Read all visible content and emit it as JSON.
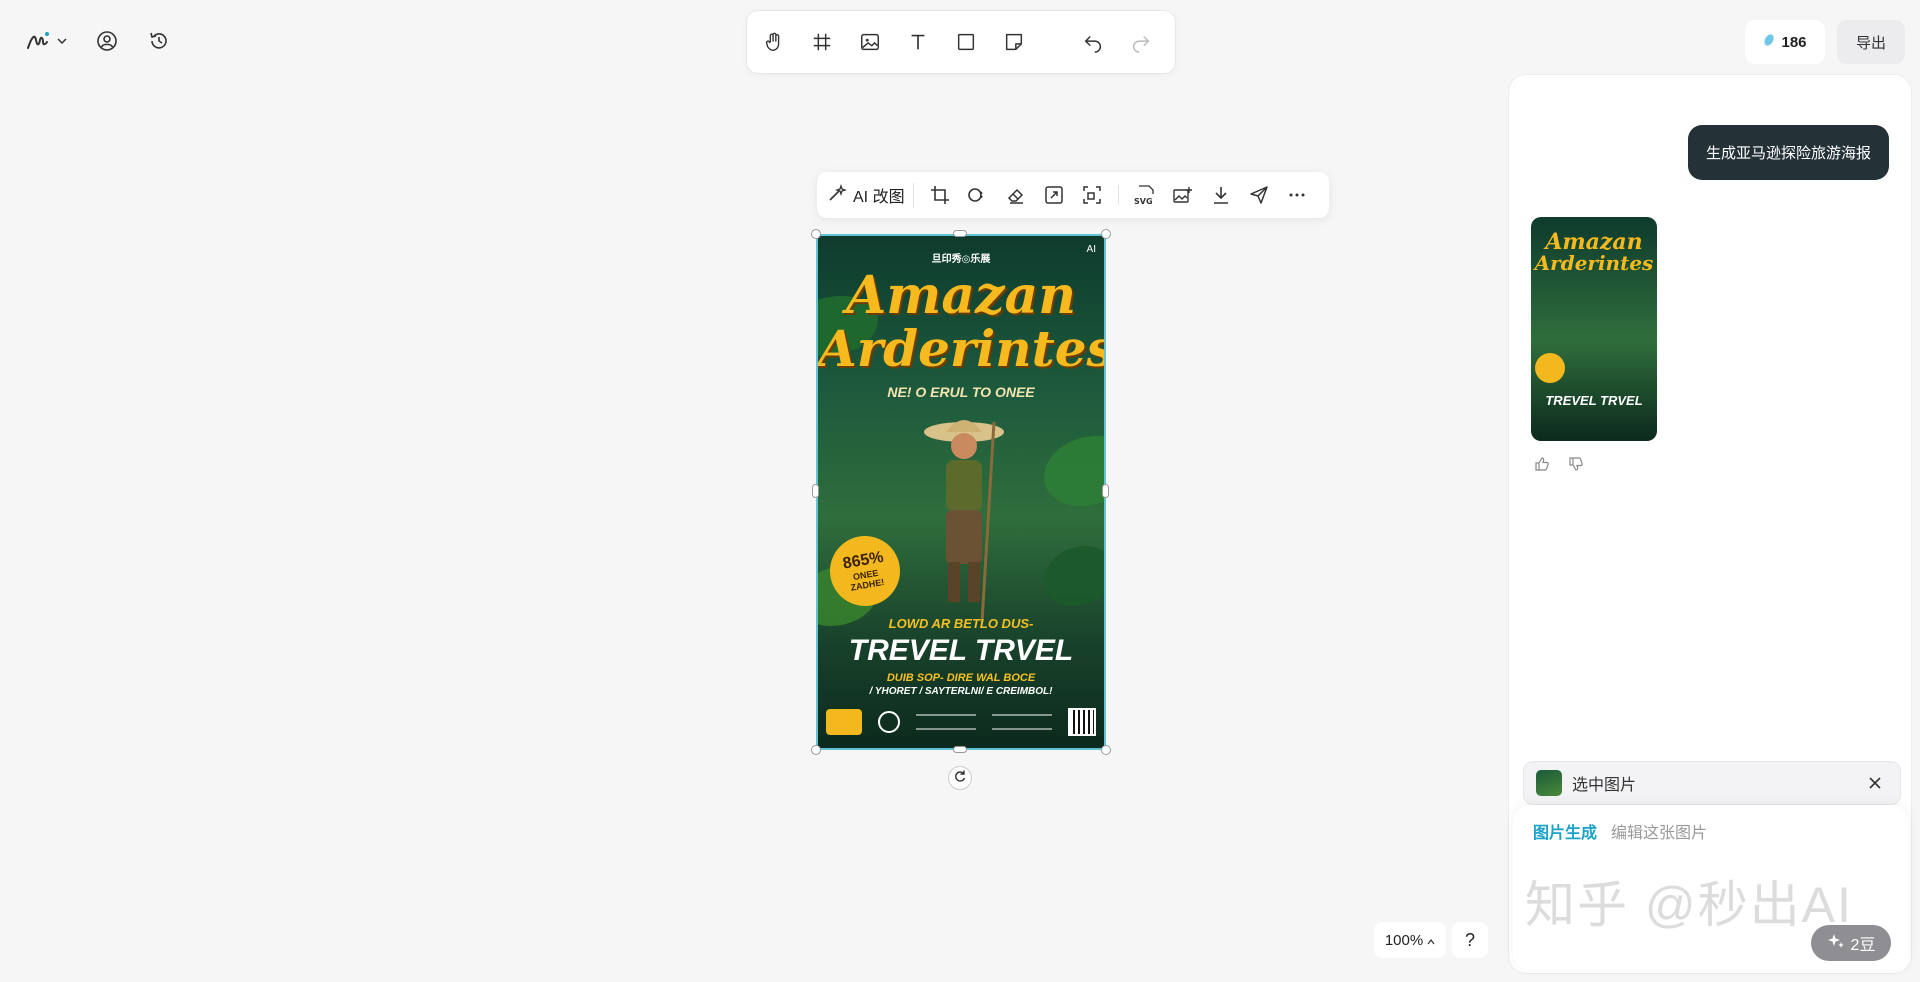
{
  "app": {
    "header_icons": [
      "pen-logo-icon",
      "chevron-down-icon",
      "user-icon",
      "history-icon"
    ]
  },
  "toolbar": {
    "tools": [
      "hand-icon",
      "frame-icon",
      "image-icon",
      "text-icon",
      "rectangle-icon",
      "sticky-note-icon",
      "undo-icon",
      "redo-icon"
    ]
  },
  "top_right": {
    "credits_value": "186",
    "export_label": "导出"
  },
  "image_toolbar": {
    "ai_edit_label": "AI 改图",
    "svg_label": "SVG"
  },
  "poster": {
    "brand": "旦印秀◎乐展",
    "ai_tag": "AI",
    "title_line1": "Amazan",
    "title_line2": "Arderintes",
    "subtitle": "NE! O ERUL TO ONEE",
    "badge_big": "865%",
    "badge_small1": "ONEE",
    "badge_small2": "ZADHE!",
    "line1": "LOWD AR BETLO DUS-",
    "line2": "TREVEL TRVEL",
    "line3": "DUIB SOP- DIRE WAL BOCE",
    "line4": "/ YHORET / SAYTERLNI/ E CREIMBOL!"
  },
  "chat": {
    "user_message": "生成亚马逊探险旅游海报"
  },
  "selection": {
    "label": "选中图片"
  },
  "input": {
    "tab_active": "图片生成",
    "tab_inactive": "编辑这张图片",
    "watermark": "知乎 @秒出AI",
    "generate_label": "2豆"
  },
  "zoom": {
    "level": "100%",
    "help_label": "?"
  },
  "colors": {
    "accent": "#1aa2c9",
    "selection_border": "#5ec4d6",
    "chat_bubble": "#243238",
    "poster_title": "#f6b91e"
  }
}
